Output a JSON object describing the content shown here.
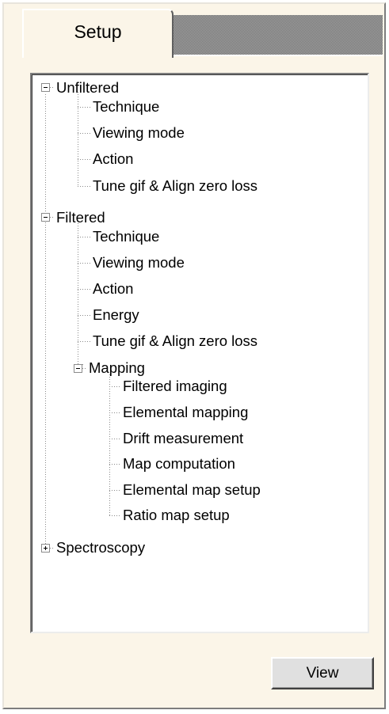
{
  "tabs": [
    {
      "label": "Setup",
      "active": true
    }
  ],
  "tree": {
    "nodes": [
      {
        "label": "Unfiltered",
        "expanded": true
      },
      {
        "label": "Technique"
      },
      {
        "label": "Viewing mode"
      },
      {
        "label": "Action"
      },
      {
        "label": "Tune gif & Align zero loss"
      },
      {
        "label": "Filtered",
        "expanded": true
      },
      {
        "label": "Technique"
      },
      {
        "label": "Viewing mode"
      },
      {
        "label": "Action"
      },
      {
        "label": "Energy"
      },
      {
        "label": "Tune gif & Align zero loss"
      },
      {
        "label": "Mapping",
        "expanded": true
      },
      {
        "label": "Filtered imaging"
      },
      {
        "label": "Elemental mapping"
      },
      {
        "label": "Drift measurement"
      },
      {
        "label": "Map computation"
      },
      {
        "label": "Elemental map setup"
      },
      {
        "label": "Ratio map setup"
      },
      {
        "label": "Spectroscopy",
        "expanded": false
      }
    ]
  },
  "buttons": {
    "view_label": "View"
  },
  "colors": {
    "panel_bg": "#fbf5e8",
    "tree_bg": "#ffffff",
    "tab_strip": "#8c8c8c",
    "button_face": "#e0e0e0"
  }
}
